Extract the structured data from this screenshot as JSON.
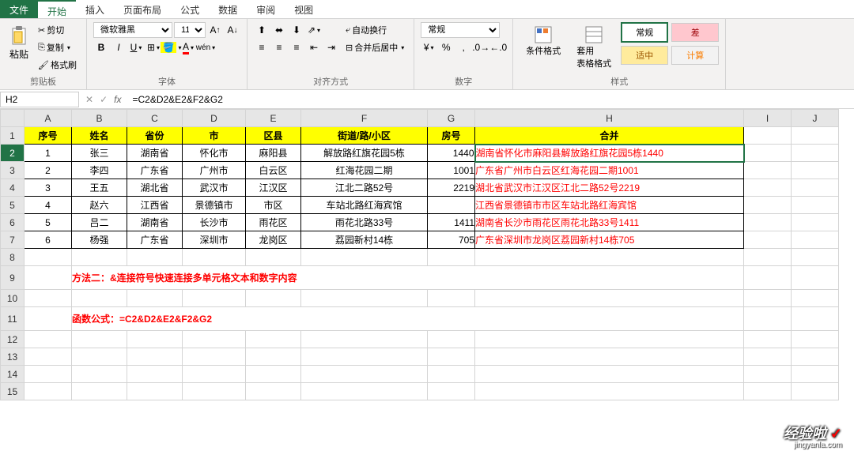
{
  "tabs": {
    "file": "文件",
    "home": "开始",
    "insert": "插入",
    "layout": "页面布局",
    "formula": "公式",
    "data": "数据",
    "review": "审阅",
    "view": "视图"
  },
  "ribbon": {
    "clipboard": {
      "paste": "粘贴",
      "cut": "剪切",
      "copy": "复制",
      "format_painter": "格式刷",
      "label": "剪贴板"
    },
    "font": {
      "name": "微软雅黑",
      "size": "11",
      "label": "字体"
    },
    "alignment": {
      "wrap": "自动换行",
      "merge": "合并后居中",
      "label": "对齐方式"
    },
    "number": {
      "format": "常规",
      "label": "数字"
    },
    "styles": {
      "conditional": "条件格式",
      "table_format": "套用\n表格格式",
      "normal": "常规",
      "bad": "差",
      "good": "适中",
      "calc": "计算",
      "label": "样式"
    }
  },
  "formula_bar": {
    "cell_ref": "H2",
    "formula": "=C2&D2&E2&F2&G2"
  },
  "columns": [
    "A",
    "B",
    "C",
    "D",
    "E",
    "F",
    "G",
    "H",
    "I",
    "J"
  ],
  "headers": {
    "seq": "序号",
    "name": "姓名",
    "province": "省份",
    "city": "市",
    "district": "区县",
    "street": "街道/路/小区",
    "room": "房号",
    "merged": "合并"
  },
  "rows": [
    {
      "seq": "1",
      "name": "张三",
      "province": "湖南省",
      "city": "怀化市",
      "district": "麻阳县",
      "street": "解放路红旗花园5栋",
      "room": "1440",
      "merged": "湖南省怀化市麻阳县解放路红旗花园5栋1440"
    },
    {
      "seq": "2",
      "name": "李四",
      "province": "广东省",
      "city": "广州市",
      "district": "白云区",
      "street": "红海花园二期",
      "room": "1001",
      "merged": "广东省广州市白云区红海花园二期1001"
    },
    {
      "seq": "3",
      "name": "王五",
      "province": "湖北省",
      "city": "武汉市",
      "district": "江汉区",
      "street": "江北二路52号",
      "room": "2219",
      "merged": "湖北省武汉市江汉区江北二路52号2219"
    },
    {
      "seq": "4",
      "name": "赵六",
      "province": "江西省",
      "city": "景德镇市",
      "district": "市区",
      "street": "车站北路红海宾馆",
      "room": "",
      "merged": "江西省景德镇市市区车站北路红海宾馆"
    },
    {
      "seq": "5",
      "name": "吕二",
      "province": "湖南省",
      "city": "长沙市",
      "district": "雨花区",
      "street": "雨花北路33号",
      "room": "1411",
      "merged": "湖南省长沙市雨花区雨花北路33号1411"
    },
    {
      "seq": "6",
      "name": "杨强",
      "province": "广东省",
      "city": "深圳市",
      "district": "龙岗区",
      "street": "荔园新村14栋",
      "room": "705",
      "merged": "广东省深圳市龙岗区荔园新村14栋705"
    }
  ],
  "notes": {
    "method": "方法二：&连接符号快速连接多单元格文本和数字内容",
    "formula_note": "函数公式：=C2&D2&E2&F2&G2"
  },
  "watermark": {
    "main": "经验啦",
    "check": "✓",
    "sub": "jingyanla.com"
  }
}
